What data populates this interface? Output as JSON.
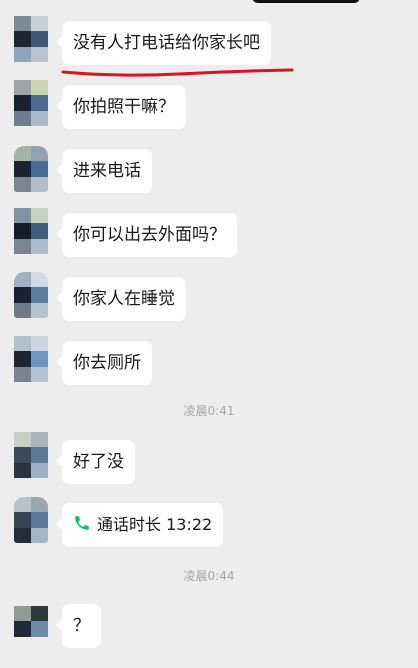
{
  "messages": [
    {
      "text": "没有人打电话给你家长吧"
    },
    {
      "text": "你拍照干嘛？"
    },
    {
      "text": "进来电话"
    },
    {
      "text": "你可以出去外面吗？"
    },
    {
      "text": "你家人在睡觉"
    },
    {
      "text": "你去厕所"
    },
    {
      "text": "好了没"
    },
    {
      "text": "通话时长 13:22",
      "icon": "phone-icon"
    },
    {
      "text": "？"
    }
  ],
  "timestamps": [
    "凌晨0:41",
    "凌晨0:44"
  ],
  "colors": {
    "background": "#ededed",
    "bubble": "#ffffff",
    "annotation": "#d9141e",
    "call_icon": "#07c160",
    "timestamp": "#a6a6a6"
  }
}
